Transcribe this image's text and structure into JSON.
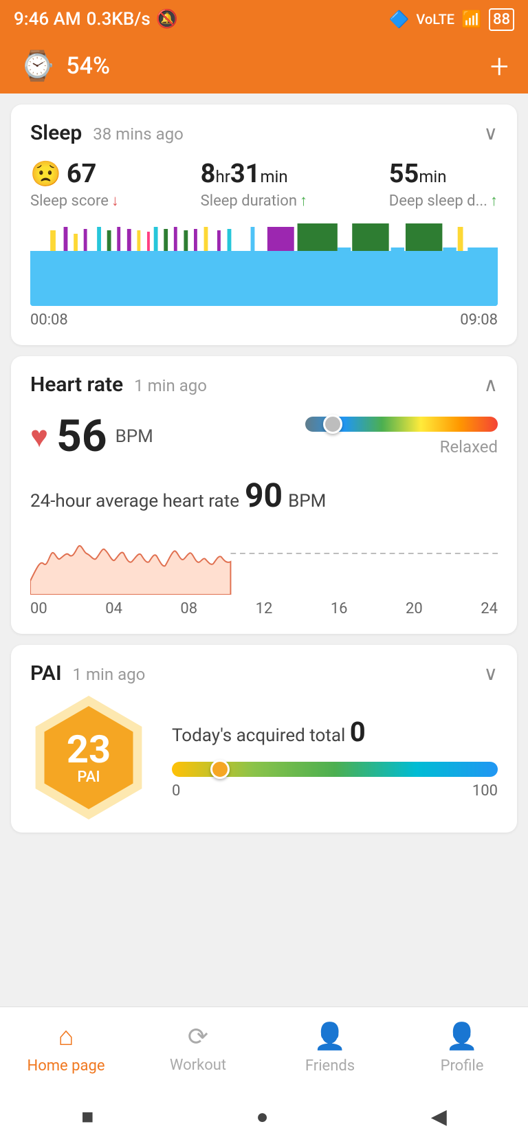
{
  "statusBar": {
    "time": "9:46 AM",
    "network": "0.3KB/s",
    "battery": "88"
  },
  "header": {
    "batteryPct": "54%",
    "addBtn": "+"
  },
  "sleep": {
    "title": "Sleep",
    "time": "38 mins ago",
    "score": "67",
    "scoreTrend": "↓",
    "scoreLabel": "Sleep score",
    "duration": "8hr31min",
    "durationHr": "8",
    "durationMin": "31",
    "durationTrend": "↑",
    "durationLabel": "Sleep duration",
    "deepSleep": "55",
    "deepSleepTrend": "↑",
    "deepSleepLabel": "Deep sleep d...",
    "startTime": "00:08",
    "endTime": "09:08"
  },
  "heartRate": {
    "title": "Heart rate",
    "time": "1 min ago",
    "bpm": "56",
    "unit": "BPM",
    "status": "Relaxed",
    "avgLabel": "24-hour average heart rate",
    "avgValue": "90",
    "avgUnit": "BPM",
    "timeLabels": [
      "00",
      "04",
      "08",
      "12",
      "16",
      "20",
      "24"
    ]
  },
  "pai": {
    "title": "PAI",
    "time": "1 min ago",
    "value": "23",
    "text": "PAI",
    "todayLabel": "Today's acquired total",
    "todayValue": "0",
    "rangeMin": "0",
    "rangeMax": "100"
  },
  "bottomNav": {
    "items": [
      {
        "id": "home",
        "label": "Home page",
        "icon": "⌂",
        "active": true
      },
      {
        "id": "workout",
        "label": "Workout",
        "icon": "⟳",
        "active": false
      },
      {
        "id": "friends",
        "label": "Friends",
        "icon": "👤",
        "active": false
      },
      {
        "id": "profile",
        "label": "Profile",
        "icon": "👤",
        "active": false
      }
    ]
  },
  "systemNav": {
    "stop": "■",
    "home": "●",
    "back": "◀"
  }
}
